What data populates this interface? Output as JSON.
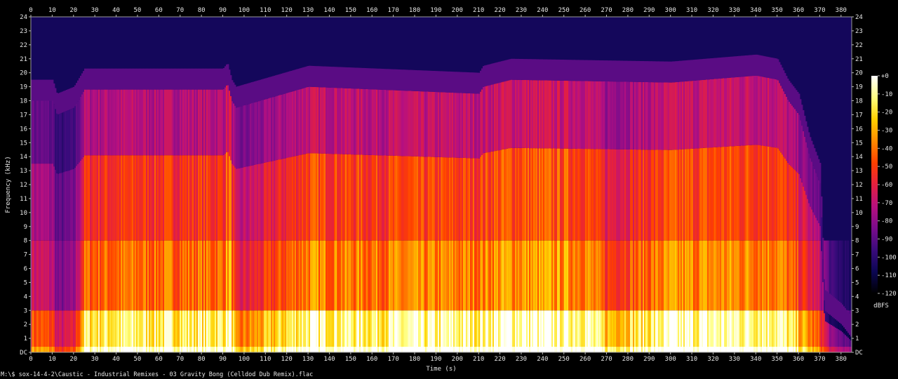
{
  "chart_data": {
    "type": "heatmap",
    "subtype": "spectrogram",
    "xlabel": "Time (s)",
    "ylabel": "Frequency (kHz)",
    "x_ticks": [
      "0",
      "10",
      "20",
      "30",
      "40",
      "50",
      "60",
      "70",
      "80",
      "90",
      "100",
      "110",
      "120",
      "130",
      "140",
      "150",
      "160",
      "170",
      "180",
      "190",
      "200",
      "210",
      "220",
      "230",
      "240",
      "250",
      "260",
      "270",
      "280",
      "290",
      "300",
      "310",
      "320",
      "330",
      "340",
      "350",
      "360",
      "370",
      "380"
    ],
    "y_ticks": [
      "DC",
      "1",
      "2",
      "3",
      "4",
      "5",
      "6",
      "7",
      "8",
      "9",
      "10",
      "11",
      "12",
      "13",
      "14",
      "15",
      "16",
      "17",
      "18",
      "19",
      "20",
      "21",
      "22",
      "23",
      "24"
    ],
    "xlim": [
      0,
      385
    ],
    "ylim": [
      0,
      24
    ],
    "colorbar": {
      "label": "dBFS",
      "ticks": [
        "+0",
        "-10",
        "-20",
        "-30",
        "-40",
        "-50",
        "-60",
        "-70",
        "-80",
        "-90",
        "-100",
        "-110",
        "-120"
      ],
      "range": [
        -120,
        0
      ],
      "colors": [
        "#000000",
        "#0b0653",
        "#3a0b7c",
        "#7a0c8c",
        "#b7107f",
        "#e5203f",
        "#ff4000",
        "#ff8a00",
        "#ffd000",
        "#ffff80",
        "#ffffff"
      ]
    },
    "bandwidth_envelope_khz": {
      "time_s": [
        0,
        5,
        10,
        12,
        20,
        25,
        90,
        92,
        94,
        96,
        130,
        210,
        212,
        225,
        300,
        340,
        350,
        355,
        360,
        365,
        370,
        372,
        380,
        385
      ],
      "upper_khz": [
        18,
        18,
        18,
        17,
        17.5,
        18.8,
        18.8,
        19.2,
        18,
        17.5,
        19,
        18.5,
        19,
        19.5,
        19.3,
        19.8,
        19.5,
        18,
        17,
        14,
        12,
        3,
        2,
        1
      ]
    },
    "energy_profile": {
      "time_s": [
        0,
        10,
        12,
        20,
        25,
        50,
        90,
        93,
        96,
        130,
        160,
        210,
        220,
        260,
        270,
        300,
        350,
        360,
        370,
        375,
        385
      ],
      "level": [
        0.55,
        0.5,
        0.35,
        0.4,
        0.78,
        0.8,
        0.8,
        0.95,
        0.55,
        0.85,
        0.82,
        0.83,
        0.88,
        0.87,
        0.7,
        0.85,
        0.86,
        0.7,
        0.5,
        0.25,
        0.15
      ]
    }
  },
  "footer": {
    "command": "M:\\$ sox-14-4-2\\Caustic - Industrial Remixes - 03 Gravity Bong (Celldod Dub Remix).flac"
  }
}
